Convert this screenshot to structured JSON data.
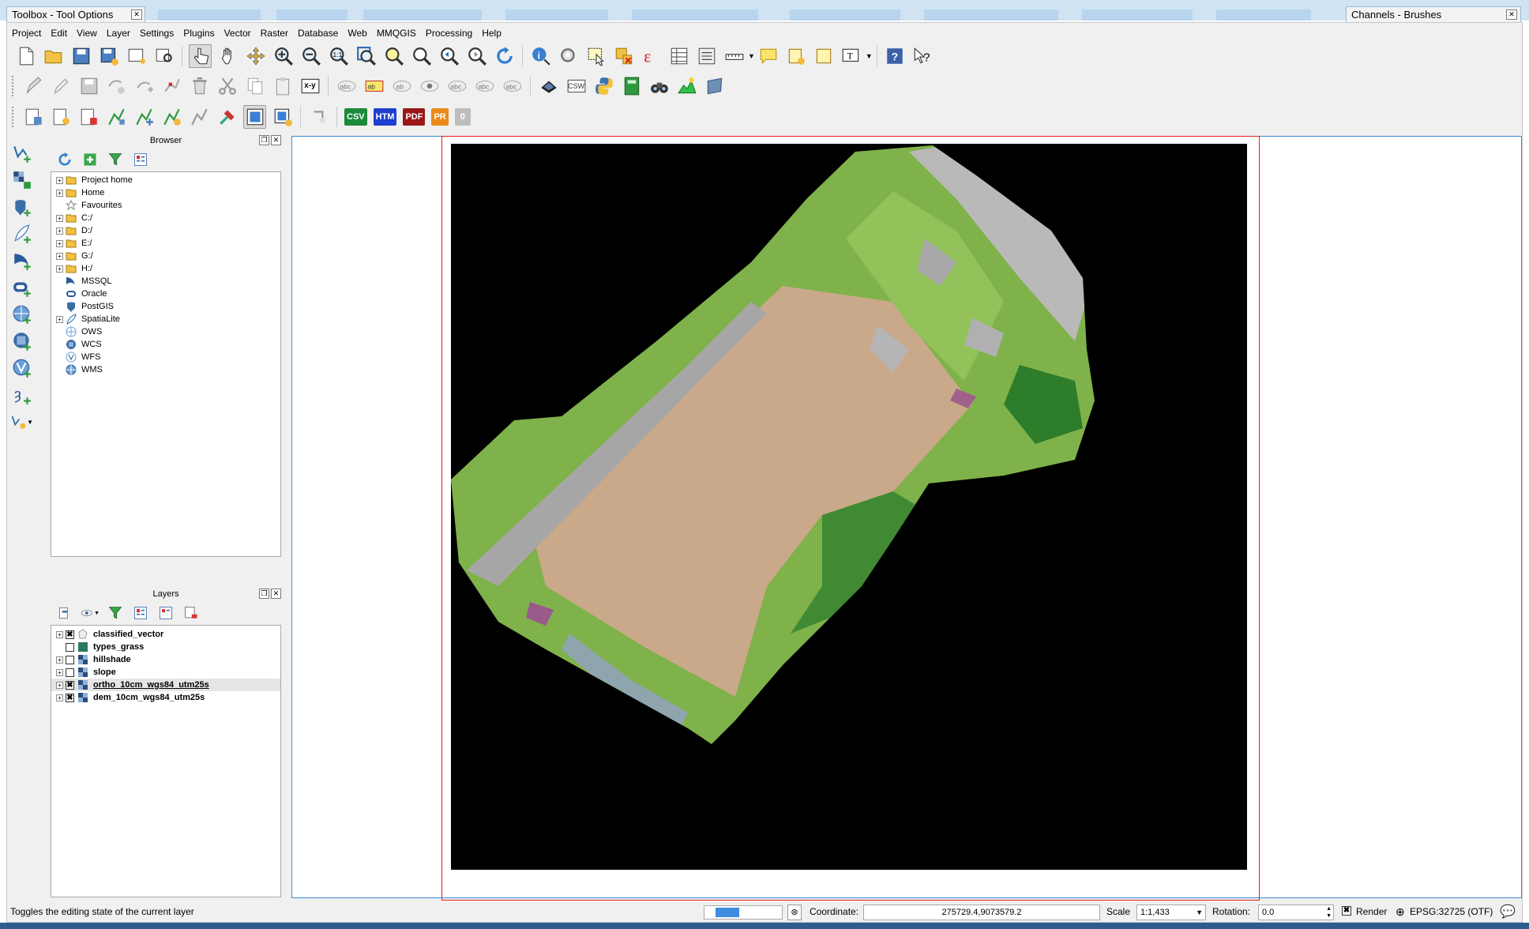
{
  "windows": {
    "left_title": "Toolbox - Tool Options",
    "right_title": "Channels - Brushes"
  },
  "menu": [
    "Project",
    "Edit",
    "View",
    "Layer",
    "Settings",
    "Plugins",
    "Vector",
    "Raster",
    "Database",
    "Web",
    "MMQGIS",
    "Processing",
    "Help"
  ],
  "toolbar3_text": {
    "csv": "CSV",
    "htm": "HTM",
    "pdf": "PDF",
    "pr": "PR",
    "zero": "0",
    "csw": "CSW",
    "xy": "x-y"
  },
  "browser": {
    "title": "Browser",
    "items": [
      "Project home",
      "Home",
      "Favourites",
      "C:/",
      "D:/",
      "E:/",
      "G:/",
      "H:/",
      "MSSQL",
      "Oracle",
      "PostGIS",
      "SpatiaLite",
      "OWS",
      "WCS",
      "WFS",
      "WMS"
    ]
  },
  "layers": {
    "title": "Layers",
    "items": [
      {
        "name": "classified_vector",
        "checked": true
      },
      {
        "name": "types_grass",
        "checked": false
      },
      {
        "name": "hillshade",
        "checked": false
      },
      {
        "name": "slope",
        "checked": false
      },
      {
        "name": "ortho_10cm_wgs84_utm25s",
        "checked": true
      },
      {
        "name": "dem_10cm_wgs84_utm25s",
        "checked": true
      }
    ],
    "check_mark": "✖"
  },
  "status": {
    "message": "Toggles the editing state of the current layer",
    "coordinate_label": "Coordinate:",
    "coordinate": "275729.4,9073579.2",
    "scale_label": "Scale",
    "scale": "1:1,433",
    "rotation_label": "Rotation:",
    "rotation": "0.0",
    "render_label": "Render",
    "crs": "EPSG:32725 (OTF)"
  },
  "colors": {
    "accent": "#3c8bd6",
    "print_frame": "#e02020",
    "field": "#c9a98a",
    "vegetation": "#6fae3f"
  }
}
